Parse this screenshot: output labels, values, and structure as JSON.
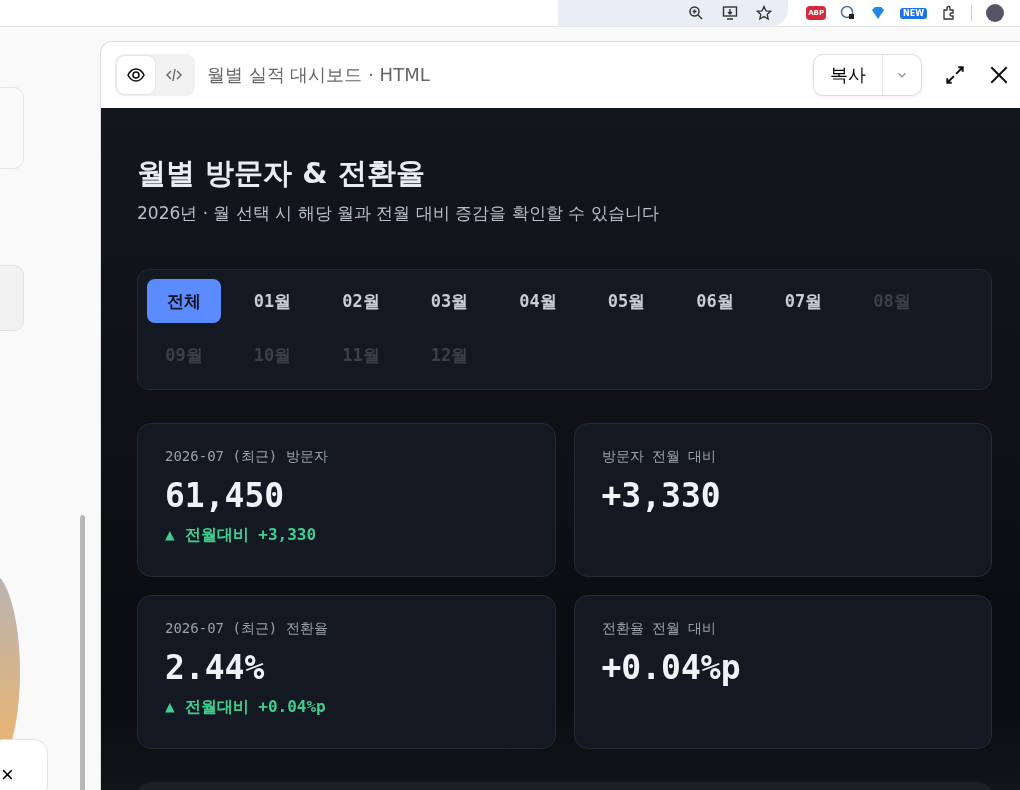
{
  "browser_toolbar": {
    "badge": "NEW",
    "adblock_label": "ABP"
  },
  "artifact": {
    "title": "월별 실적 대시보드 · HTML",
    "view_modes": [
      {
        "kind": "preview",
        "selected": true
      },
      {
        "kind": "code",
        "selected": false
      }
    ],
    "copy_button": "복사"
  },
  "dashboard": {
    "title": "월별 방문자 & 전환율",
    "subtitle": "2026년 · 월 선택 시 해당 월과 전월 대비 증감을 확인할 수 있습니다",
    "months": [
      {
        "label": "전체",
        "selected": true,
        "disabled": false
      },
      {
        "label": "01월",
        "selected": false,
        "disabled": false
      },
      {
        "label": "02월",
        "selected": false,
        "disabled": false
      },
      {
        "label": "03월",
        "selected": false,
        "disabled": false
      },
      {
        "label": "04월",
        "selected": false,
        "disabled": false
      },
      {
        "label": "05월",
        "selected": false,
        "disabled": false
      },
      {
        "label": "06월",
        "selected": false,
        "disabled": false
      },
      {
        "label": "07월",
        "selected": false,
        "disabled": false
      },
      {
        "label": "08월",
        "selected": false,
        "disabled": true
      },
      {
        "label": "09월",
        "selected": false,
        "disabled": true
      },
      {
        "label": "10월",
        "selected": false,
        "disabled": true
      },
      {
        "label": "11월",
        "selected": false,
        "disabled": true
      },
      {
        "label": "12월",
        "selected": false,
        "disabled": true
      }
    ],
    "cards": [
      {
        "label": "2026-07 (최근) 방문자",
        "value": "61,450",
        "delta": {
          "arrow": "▲",
          "text": "전월대비 +3,330"
        }
      },
      {
        "label": "방문자 전월 대비",
        "value": "+3,330"
      },
      {
        "label": "2026-07 (최근) 전환율",
        "value": "2.44%",
        "delta": {
          "arrow": "▲",
          "text": "전월대비 +0.04%p"
        }
      },
      {
        "label": "전환율 전월 대비",
        "value": "+0.04%p"
      }
    ]
  },
  "left_pane": {
    "close_label": "×"
  }
}
